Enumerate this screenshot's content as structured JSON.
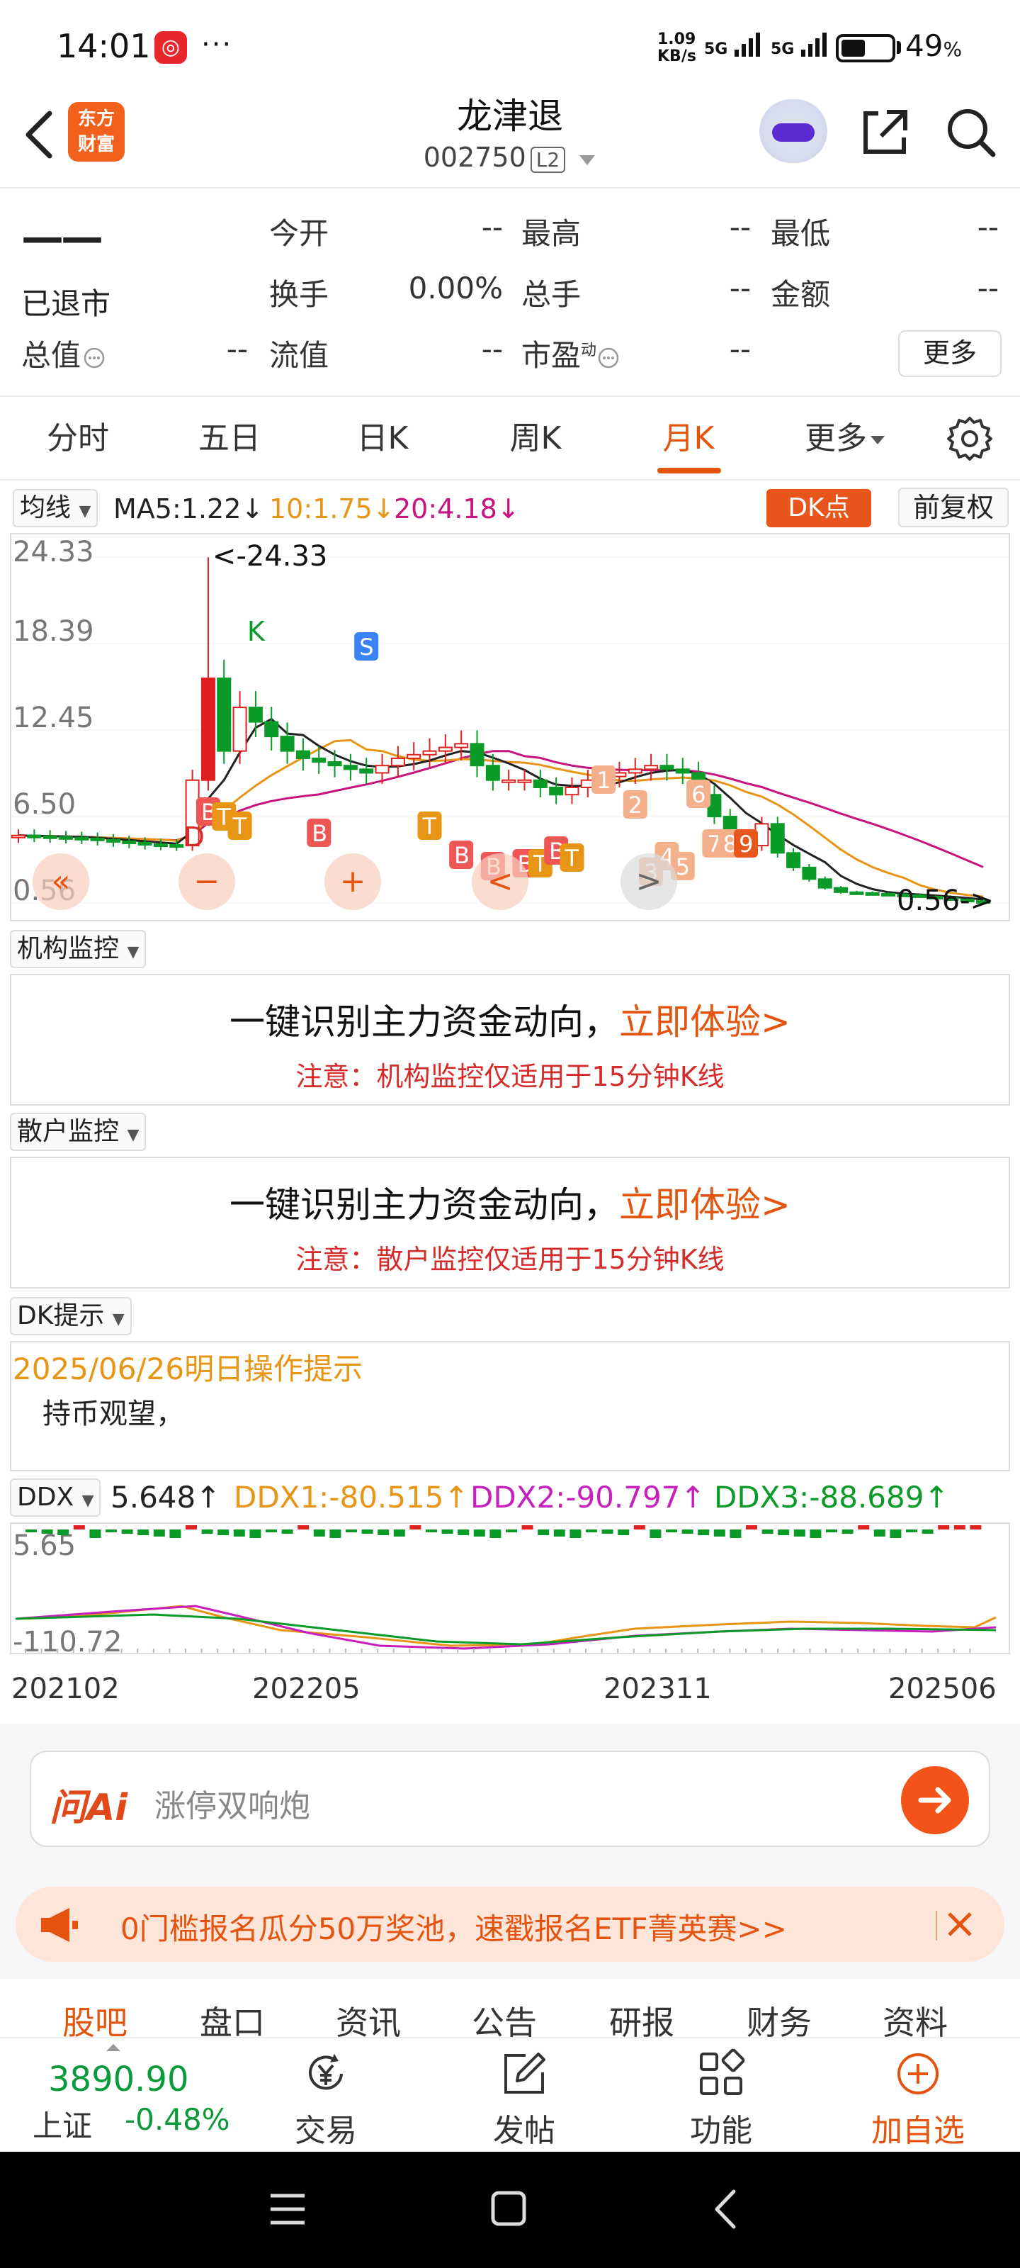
{
  "status_bar": {
    "time": "14:01",
    "app_badge": "◎",
    "dots": "···",
    "net_speed_value": "1.09",
    "net_speed_unit": "KB/s",
    "sim1": "5G",
    "sim2": "5G",
    "battery_pct": "49",
    "battery_unit": "%",
    "battery_level": 0.49
  },
  "header": {
    "logo_line1": "东方",
    "logo_line2": "财富",
    "stock_name": "龙津退",
    "stock_code": "002750",
    "level_badge": "L2"
  },
  "quote": {
    "price": "——",
    "status": "已退市",
    "rows": [
      [
        {
          "label": "今开",
          "value": "--"
        },
        {
          "label": "最高",
          "value": "--"
        },
        {
          "label": "最低",
          "value": "--"
        }
      ],
      [
        {
          "label": "换手",
          "value": "0.00%"
        },
        {
          "label": "总手",
          "value": "--"
        },
        {
          "label": "金额",
          "value": "--"
        }
      ],
      [
        {
          "label": "总值",
          "value": "--"
        },
        {
          "label": "流值",
          "value": "--"
        },
        {
          "label": "市盈",
          "value": "--"
        }
      ]
    ],
    "pe_superscript": "动",
    "more_button": "更多"
  },
  "period_tabs": [
    "分时",
    "五日",
    "日K",
    "周K",
    "月K",
    "更多"
  ],
  "active_period": "月K",
  "ma_bar": {
    "selector": "均线",
    "ma5": "MA5:1.22↓",
    "ma10": "10:1.75↓",
    "ma20": "20:4.18↓",
    "dk_point": "DK点",
    "adjust": "前复权",
    "colors": {
      "ma5": "#222222",
      "ma10": "#e89516",
      "ma20": "#c7127f"
    }
  },
  "chart_data": {
    "type": "candlestick",
    "y_ticks": [
      "24.33",
      "18.39",
      "12.45",
      "6.50",
      "0.56"
    ],
    "ylim": [
      0.56,
      24.33
    ],
    "max_label": "<-24.33",
    "min_label": "0.56->",
    "markers": [
      "D",
      "B",
      "T",
      "T",
      "K",
      "B",
      "S",
      "T",
      "B",
      "B",
      "B",
      "T",
      "B",
      "T",
      "1",
      "2",
      "3",
      "4",
      "5",
      "6",
      "7",
      "8",
      "9"
    ],
    "up_color": "#e02020",
    "down_color": "#0a9a28"
  },
  "chart_controls": [
    "«",
    "−",
    "+",
    "<",
    ">"
  ],
  "institution_panel": {
    "selector": "机构监控",
    "title": "一键识别主力资金动向，",
    "cta": "立即体验>",
    "note": "注意：机构监控仅适用于15分钟K线"
  },
  "retail_panel": {
    "selector": "散户监控",
    "title": "一键识别主力资金动向，",
    "cta": "立即体验>",
    "note": "注意：散户监控仅适用于15分钟K线"
  },
  "dk_tip": {
    "selector": "DK提示",
    "date_line": "2025/06/26明日操作提示",
    "advice": "持币观望，"
  },
  "ddx": {
    "selector": "DDX",
    "ddx": "5.648↑",
    "ddx1": "DDX1:-80.515↑",
    "ddx2": "DDX2:-90.797↑",
    "ddx3": "DDX3:-88.689↑",
    "y_top": "5.65",
    "y_bottom": "-110.72",
    "colors": {
      "ddx1": "#e89516",
      "ddx2": "#c71fbd",
      "ddx3": "#0a9a28"
    }
  },
  "x_axis": [
    "202102",
    "202205",
    "202311",
    "202506"
  ],
  "ai_search": {
    "logo": "问Ai",
    "placeholder": "涨停双响炮"
  },
  "promo": {
    "text": "0门槛报名瓜分50万奖池，速戳报名ETF菁英赛>>"
  },
  "bottom_tabs": [
    "股吧",
    "盘口",
    "资讯",
    "公告",
    "研报",
    "财务",
    "资料"
  ],
  "active_bottom_tab": "股吧",
  "index": {
    "value": "3890.90",
    "name": "上证",
    "change": "-0.48%"
  },
  "bottom_nav": [
    {
      "label": "交易",
      "icon": "yen-icon"
    },
    {
      "label": "发帖",
      "icon": "edit-icon"
    },
    {
      "label": "功能",
      "icon": "grid-icon"
    },
    {
      "label": "加自选",
      "icon": "plus-circle-icon"
    }
  ]
}
